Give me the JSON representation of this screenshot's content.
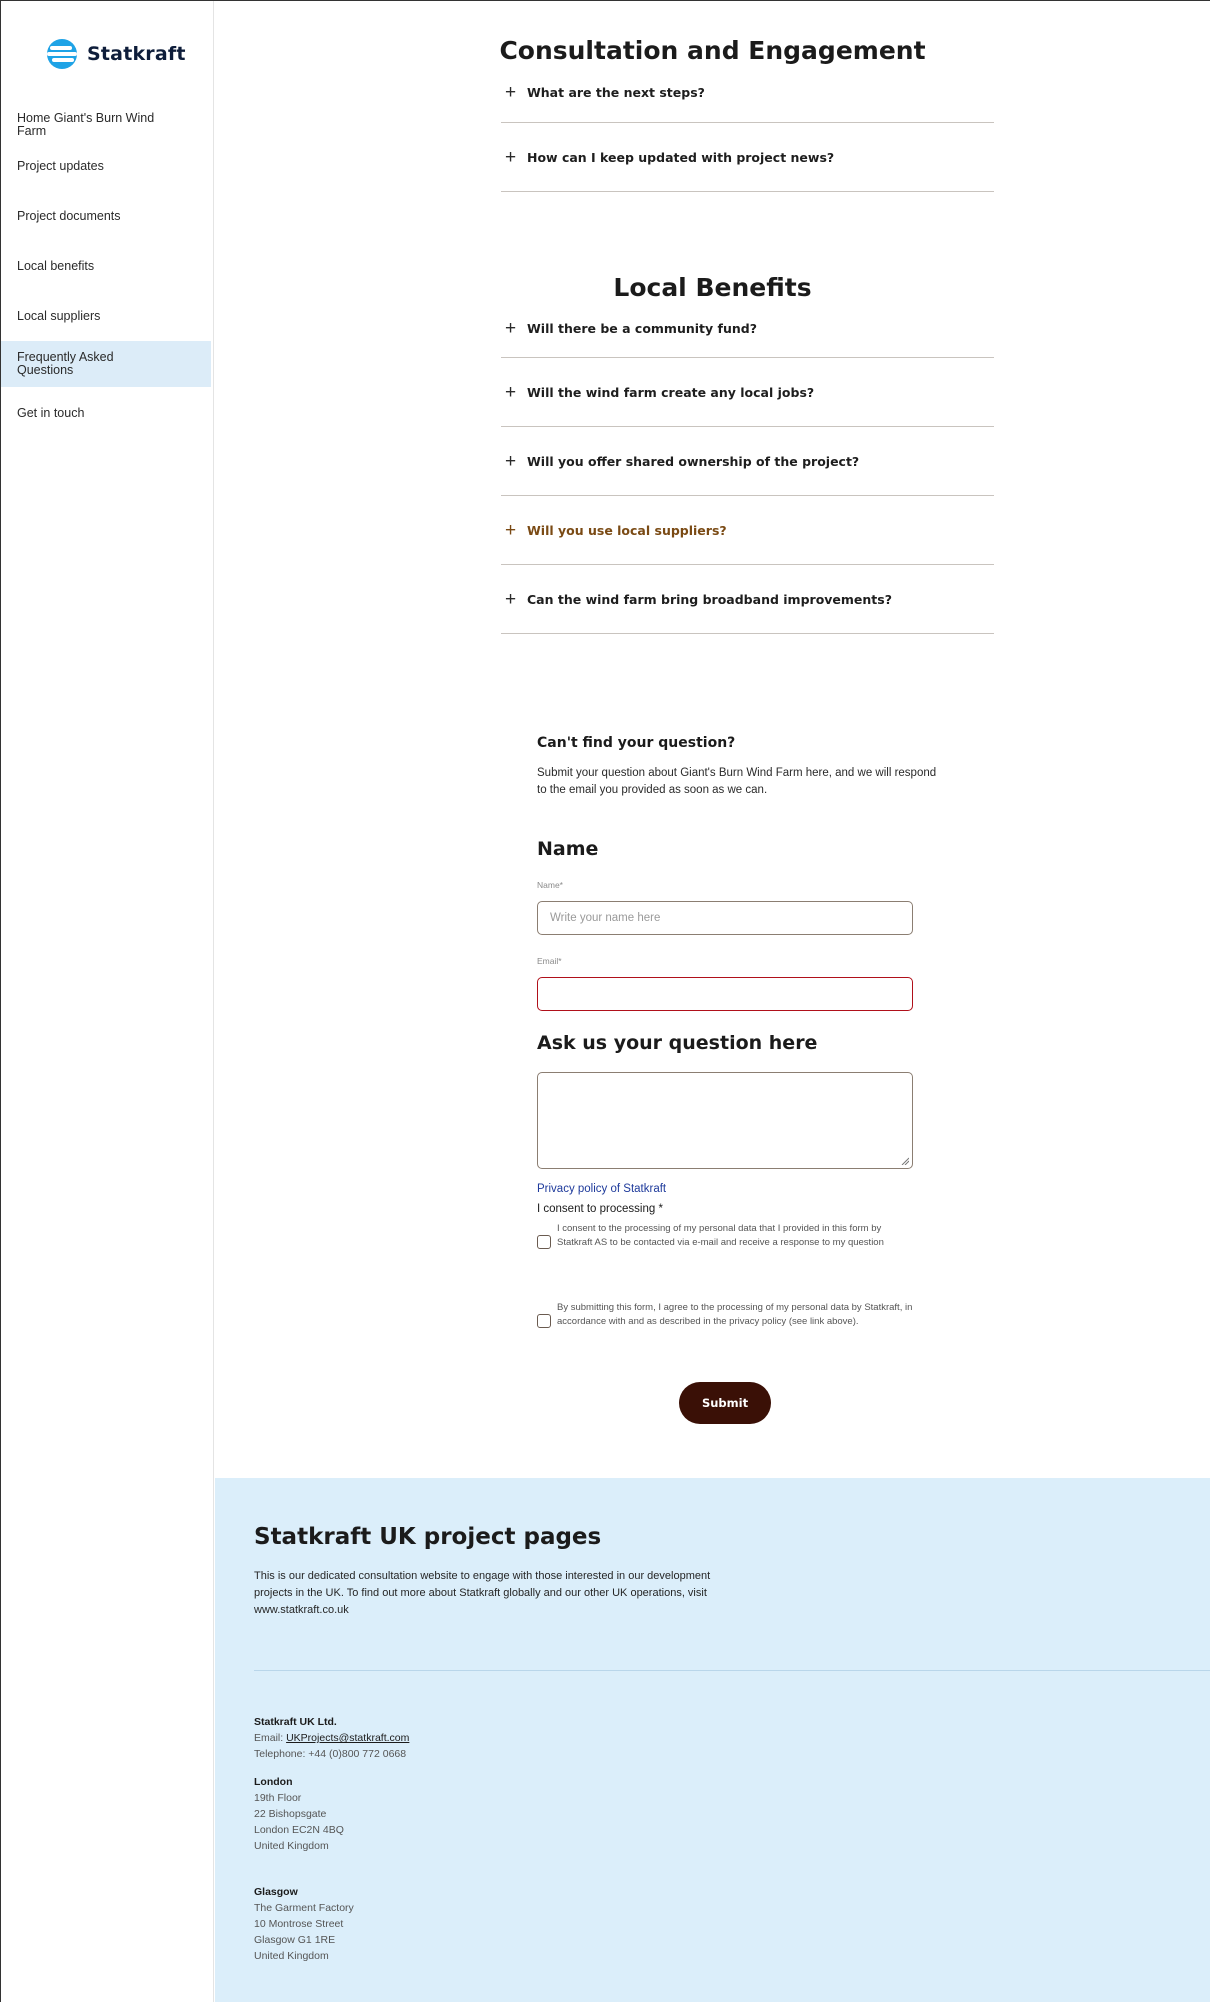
{
  "brand": {
    "name": "Statkraft",
    "logo_color": "#1fa3e6"
  },
  "sidebar": {
    "items": [
      {
        "label": "Home Giant's Burn Wind Farm",
        "active": false
      },
      {
        "label": "Project updates",
        "active": false
      },
      {
        "label": "Project documents",
        "active": false
      },
      {
        "label": "Local benefits",
        "active": false
      },
      {
        "label": "Local suppliers",
        "active": false
      },
      {
        "label": "Frequently Asked Questions",
        "active": true
      },
      {
        "label": "Get in touch",
        "active": false
      }
    ]
  },
  "sections": {
    "consultation": {
      "title": "Consultation and Engagement",
      "questions": [
        "What are the next steps?",
        "How can I keep updated with project news?"
      ]
    },
    "local_benefits": {
      "title": "Local Benefits",
      "questions": [
        "Will there be a community fund?",
        "Will the wind farm create any local jobs?",
        "Will you offer shared ownership of the project?",
        "Will you use local suppliers?",
        "Can the wind farm bring broadband improvements?"
      ]
    }
  },
  "form": {
    "heading": "Can't find your question?",
    "intro": "Submit your question about Giant's Burn Wind Farm here, and we will respond to the email you provided as soon as we can.",
    "name_heading": "Name",
    "name_label": "Name*",
    "name_placeholder": "Write your name here",
    "email_label": "Email*",
    "email_value": "",
    "question_heading": "Ask us your question here",
    "privacy_link": "Privacy policy of Statkraft",
    "consent_title": "I consent to processing *",
    "consent_1": "I consent to the processing of my personal data that I provided in this form by Statkraft AS to be contacted via e-mail and receive a response to my question",
    "consent_2": "By submitting this form, I agree to the processing of my personal data by Statkraft, in accordance with and as described in the privacy policy (see link above).",
    "submit_label": "Submit",
    "submit_color": "#3a1006",
    "error_border_color": "#b0101a"
  },
  "footer": {
    "title": "Statkraft UK project pages",
    "description": "This is our dedicated consultation website to engage with those interested in our development projects in the UK. To find out more about Statkraft globally and our other UK operations, visit www.statkraft.co.uk",
    "company": "Statkraft UK Ltd.",
    "email_prefix": "Email: ",
    "email": "UKProjects@statkraft.com",
    "telephone": "Telephone: +44 (0)800 772 0668",
    "london": {
      "heading": "London",
      "lines": [
        "19th Floor",
        "22 Bishopsgate",
        "London EC2N 4BQ",
        "United Kingdom"
      ]
    },
    "glasgow": {
      "heading": "Glasgow",
      "lines": [
        "The Garment Factory",
        "10 Montrose Street",
        "Glasgow G1 1RE",
        "United Kingdom"
      ]
    },
    "background_color": "#dbeefa"
  }
}
